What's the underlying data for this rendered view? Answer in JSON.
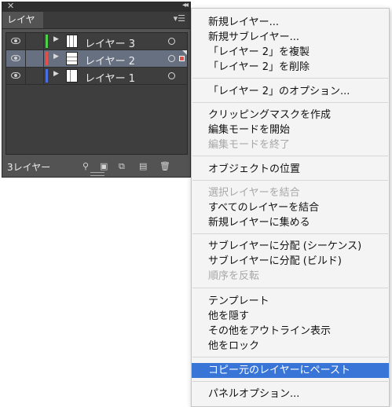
{
  "panel": {
    "close_glyph": "✕",
    "collapse_glyph": "◂◂",
    "tab_label": "レイヤー",
    "menu_icon": "menu-icon",
    "layers": [
      {
        "name": "レイヤー 3",
        "color": "#4fd04a",
        "selected": false
      },
      {
        "name": "レイヤー 2",
        "color": "#e2504c",
        "selected": true
      },
      {
        "name": "レイヤー 1",
        "color": "#4a6fe0",
        "selected": false
      }
    ],
    "footer": {
      "count_label": "3レイヤー",
      "icons": [
        "locate-object-icon",
        "make-clipping-mask-icon",
        "create-sublayer-icon",
        "create-new-layer-icon",
        "delete-icon"
      ]
    }
  },
  "menu": {
    "items": [
      {
        "label": "新規レイヤー...",
        "disabled": false
      },
      {
        "label": "新規サブレイヤー...",
        "disabled": false
      },
      {
        "label": "「レイヤー 2」を複製",
        "disabled": false
      },
      {
        "label": "「レイヤー 2」を削除",
        "disabled": false
      },
      {
        "label": "「レイヤー 2」のオプション...",
        "disabled": false
      },
      {
        "label": "クリッピングマスクを作成",
        "disabled": false
      },
      {
        "label": "編集モードを開始",
        "disabled": false
      },
      {
        "label": "編集モードを終了",
        "disabled": true
      },
      {
        "label": "オブジェクトの位置",
        "disabled": false
      },
      {
        "label": "選択レイヤーを結合",
        "disabled": true
      },
      {
        "label": "すべてのレイヤーを結合",
        "disabled": false
      },
      {
        "label": "新規レイヤーに集める",
        "disabled": false
      },
      {
        "label": "サブレイヤーに分配 (シーケンス)",
        "disabled": false
      },
      {
        "label": "サブレイヤーに分配 (ビルド)",
        "disabled": false
      },
      {
        "label": "順序を反転",
        "disabled": true
      },
      {
        "label": "テンプレート",
        "disabled": false
      },
      {
        "label": "他を隠す",
        "disabled": false
      },
      {
        "label": "その他をアウトライン表示",
        "disabled": false
      },
      {
        "label": "他をロック",
        "disabled": false
      },
      {
        "label": "コピー元のレイヤーにペースト",
        "disabled": false,
        "highlighted": true
      },
      {
        "label": "パネルオプション...",
        "disabled": false
      }
    ],
    "highlight_color": "#3875d7"
  }
}
